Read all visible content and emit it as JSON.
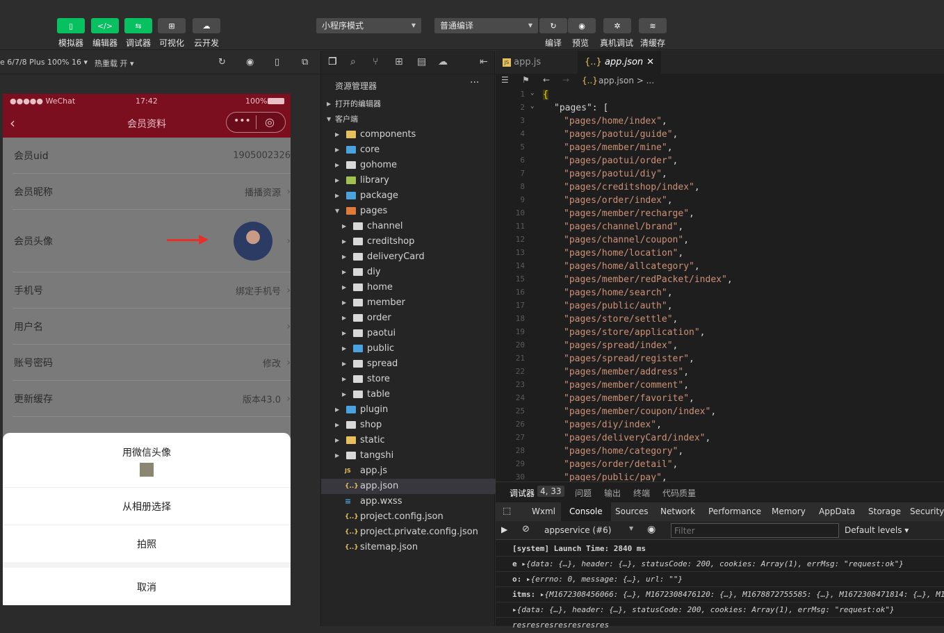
{
  "toolbar": {
    "buttons": [
      {
        "label": "模拟器",
        "glyph": "▯"
      },
      {
        "label": "编辑器",
        "glyph": "</>"
      },
      {
        "label": "调试器",
        "glyph": "⇆"
      },
      {
        "label": "可视化",
        "glyph": "⊞"
      },
      {
        "label": "云开发",
        "glyph": "☁"
      }
    ],
    "mode_select": "小程序模式",
    "compile_select": "普通编译",
    "actions": [
      {
        "label": "编译",
        "glyph": "↻"
      },
      {
        "label": "预览",
        "glyph": "◉"
      },
      {
        "label": "真机调试",
        "glyph": "✲"
      },
      {
        "label": "清缓存",
        "glyph": "≋"
      }
    ]
  },
  "simulator": {
    "device": "e 6/7/8 Plus 100% 16",
    "hot_reload": "热重载 开",
    "status_left": "●●●●● WeChat",
    "status_time": "17:42",
    "status_battery": "100%",
    "nav_title": "会员资料",
    "rows": [
      {
        "label": "会员uid",
        "value": "1905002326"
      },
      {
        "label": "会员昵称",
        "value": "播播资源"
      },
      {
        "label": "会员头像",
        "value": ""
      },
      {
        "label": "手机号",
        "value": "绑定手机号"
      },
      {
        "label": "用户名",
        "value": ""
      },
      {
        "label": "账号密码",
        "value": "修改"
      },
      {
        "label": "更新缓存",
        "value": "版本43.0"
      }
    ],
    "sheet": {
      "option1": "用微信头像",
      "option2": "从相册选择",
      "option3": "拍照",
      "cancel": "取消"
    }
  },
  "explorer": {
    "title": "资源管理器",
    "open_editors": "打开的编辑器",
    "client": "客户端",
    "items": [
      {
        "label": "components",
        "depth": 1,
        "kind": "folder-y"
      },
      {
        "label": "core",
        "depth": 1,
        "kind": "folder-b"
      },
      {
        "label": "gohome",
        "depth": 1,
        "kind": "folder"
      },
      {
        "label": "library",
        "depth": 1,
        "kind": "folder-g"
      },
      {
        "label": "package",
        "depth": 1,
        "kind": "folder-b"
      },
      {
        "label": "pages",
        "depth": 1,
        "kind": "folder-o",
        "open": true
      },
      {
        "label": "channel",
        "depth": 2,
        "kind": "folder"
      },
      {
        "label": "creditshop",
        "depth": 2,
        "kind": "folder"
      },
      {
        "label": "deliveryCard",
        "depth": 2,
        "kind": "folder"
      },
      {
        "label": "diy",
        "depth": 2,
        "kind": "folder"
      },
      {
        "label": "home",
        "depth": 2,
        "kind": "folder"
      },
      {
        "label": "member",
        "depth": 2,
        "kind": "folder"
      },
      {
        "label": "order",
        "depth": 2,
        "kind": "folder"
      },
      {
        "label": "paotui",
        "depth": 2,
        "kind": "folder"
      },
      {
        "label": "public",
        "depth": 2,
        "kind": "folder-b"
      },
      {
        "label": "spread",
        "depth": 2,
        "kind": "folder"
      },
      {
        "label": "store",
        "depth": 2,
        "kind": "folder"
      },
      {
        "label": "table",
        "depth": 2,
        "kind": "folder"
      },
      {
        "label": "plugin",
        "depth": 1,
        "kind": "folder-b"
      },
      {
        "label": "shop",
        "depth": 1,
        "kind": "folder"
      },
      {
        "label": "static",
        "depth": 1,
        "kind": "folder-y"
      },
      {
        "label": "tangshi",
        "depth": 1,
        "kind": "folder"
      },
      {
        "label": "app.js",
        "depth": 1,
        "kind": "js"
      },
      {
        "label": "app.json",
        "depth": 1,
        "kind": "json",
        "selected": true
      },
      {
        "label": "app.wxss",
        "depth": 1,
        "kind": "css"
      },
      {
        "label": "project.config.json",
        "depth": 1,
        "kind": "json"
      },
      {
        "label": "project.private.config.json",
        "depth": 1,
        "kind": "json"
      },
      {
        "label": "sitemap.json",
        "depth": 1,
        "kind": "json"
      }
    ]
  },
  "editor": {
    "tabs": [
      {
        "label": "app.js",
        "active": false
      },
      {
        "label": "app.json",
        "active": true
      }
    ],
    "breadcrumb": "app.json > ...",
    "brace": "{",
    "pages_key": "\"pages\": [",
    "pages": [
      "pages/home/index",
      "pages/paotui/guide",
      "pages/member/mine",
      "pages/paotui/order",
      "pages/paotui/diy",
      "pages/creditshop/index",
      "pages/order/index",
      "pages/member/recharge",
      "pages/channel/brand",
      "pages/channel/coupon",
      "pages/home/location",
      "pages/home/allcategory",
      "pages/member/redPacket/index",
      "pages/home/search",
      "pages/public/auth",
      "pages/store/settle",
      "pages/store/application",
      "pages/spread/index",
      "pages/spread/register",
      "pages/member/address",
      "pages/member/comment",
      "pages/member/favorite",
      "pages/member/coupon/index",
      "pages/diy/index",
      "pages/deliveryCard/index",
      "pages/home/category",
      "pages/order/detail",
      "pages/public/pay"
    ]
  },
  "debugger": {
    "tabs": [
      "调试器",
      "4, 33",
      "问题",
      "输出",
      "终端",
      "代码质量"
    ],
    "subtabs": [
      "Wxml",
      "Console",
      "Sources",
      "Network",
      "Performance",
      "Memory",
      "AppData",
      "Storage",
      "Security"
    ],
    "context": "appservice (#6)",
    "filter_placeholder": "Filter",
    "levels": "Default levels",
    "lines": [
      {
        "prefix": "",
        "text": "[system] Launch Time: 2840 ms"
      },
      {
        "prefix": "e ",
        "text": "▸{data: {…}, header: {…}, statusCode: 200, cookies: Array(1), errMsg: \"request:ok\"}"
      },
      {
        "prefix": "o: ",
        "text": "▸{errno: 0, message: {…}, url: \"\"}"
      },
      {
        "prefix": "itms: ",
        "text": "▸{M1672308456066: {…}, M1672308476120: {…}, M1678872755585: {…}, M1672308471814: {…}, M1"
      },
      {
        "prefix": "",
        "text": "▸{data: {…}, header: {…}, statusCode: 200, cookies: Array(1), errMsg: \"request:ok\"}"
      },
      {
        "prefix": "",
        "text": "resresresresresresres"
      }
    ]
  }
}
